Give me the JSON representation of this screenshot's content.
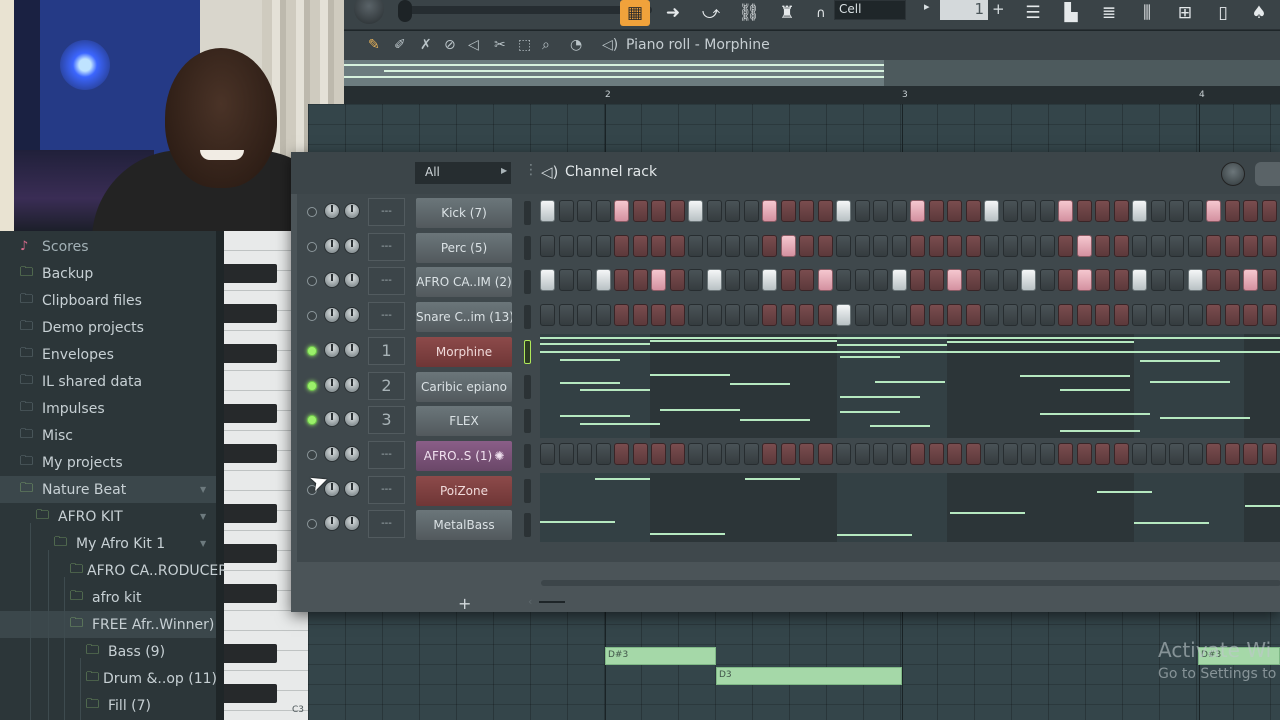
{
  "toolbar": {
    "snap": "Cell",
    "pattern_number": "1",
    "pattern_add": "+",
    "snap_arrow": "▸"
  },
  "piano_roll": {
    "title": "Piano roll - Morphine",
    "bar_numbers": [
      "2",
      "3",
      "4"
    ],
    "notes": [
      "D#3",
      "D3",
      "D#3"
    ],
    "key_label": "C3"
  },
  "browser": {
    "items": [
      {
        "label": "Scores",
        "icon": "music-note-icon"
      },
      {
        "label": "Backup",
        "icon": "folder-link-icon"
      },
      {
        "label": "Clipboard files",
        "icon": "folder-icon"
      },
      {
        "label": "Demo projects",
        "icon": "folder-icon"
      },
      {
        "label": "Envelopes",
        "icon": "folder-icon"
      },
      {
        "label": "IL shared data",
        "icon": "folder-icon"
      },
      {
        "label": "Impulses",
        "icon": "folder-icon"
      },
      {
        "label": "Misc",
        "icon": "folder-icon"
      },
      {
        "label": "My projects",
        "icon": "folder-icon"
      },
      {
        "label": "Nature Beat",
        "icon": "folder-link-icon"
      },
      {
        "label": "AFRO KIT",
        "icon": "folder-link-icon"
      },
      {
        "label": "My Afro Kit 1",
        "icon": "folder-link-icon"
      },
      {
        "label": "AFRO CA..RODUCER",
        "icon": "folder-link-icon"
      },
      {
        "label": "afro kit",
        "icon": "folder-link-icon"
      },
      {
        "label": "FREE Afr..Winner)",
        "icon": "folder-link-icon"
      },
      {
        "label": "Bass (9)",
        "icon": "folder-link-icon"
      },
      {
        "label": "Drum &..op (11)",
        "icon": "folder-link-icon"
      },
      {
        "label": "Fill (7)",
        "icon": "folder-link-icon"
      }
    ]
  },
  "channel_rack": {
    "title": "Channel rack",
    "filter": "All",
    "add_label": "+",
    "channels": [
      {
        "name": "Kick (7)",
        "route": "---",
        "style": "grey",
        "led_on": false
      },
      {
        "name": "Perc (5)",
        "route": "---",
        "style": "grey",
        "led_on": false
      },
      {
        "name": "AFRO CA..IM (2)",
        "route": "---",
        "style": "grey",
        "led_on": false
      },
      {
        "name": "Snare C..im (13)",
        "route": "---",
        "style": "grey",
        "led_on": false
      },
      {
        "name": "Morphine",
        "route": "1",
        "style": "red",
        "led_on": true
      },
      {
        "name": "Caribic epiano",
        "route": "2",
        "style": "grey",
        "led_on": true
      },
      {
        "name": "FLEX",
        "route": "3",
        "style": "grey",
        "led_on": true
      },
      {
        "name": "AFRO..S (1)",
        "route": "---",
        "style": "purple",
        "led_on": false
      },
      {
        "name": "PoiZone",
        "route": "---",
        "style": "red",
        "led_on": false
      },
      {
        "name": "MetalBass",
        "route": "---",
        "style": "grey",
        "led_on": false
      }
    ],
    "step_patterns": {
      "kick": [
        0,
        4,
        8,
        12,
        16,
        20,
        24,
        28,
        32,
        36
      ],
      "kick_pink": [
        4,
        12,
        20,
        28,
        36
      ],
      "perc": [
        13,
        29
      ],
      "afro_ca": [
        0,
        3,
        6,
        9,
        12,
        15,
        19,
        22,
        26,
        29,
        32,
        35,
        38
      ],
      "afro_ca_pink": [
        6,
        15,
        22,
        29,
        38
      ],
      "snare": [
        16
      ]
    }
  },
  "watermark": {
    "line1": "Activate Wi",
    "line2": "Go to Settings to"
  },
  "colors": {
    "accent_orange": "#f0a23b",
    "led_green": "#9bf06a",
    "note_green": "#a5d8a8"
  }
}
